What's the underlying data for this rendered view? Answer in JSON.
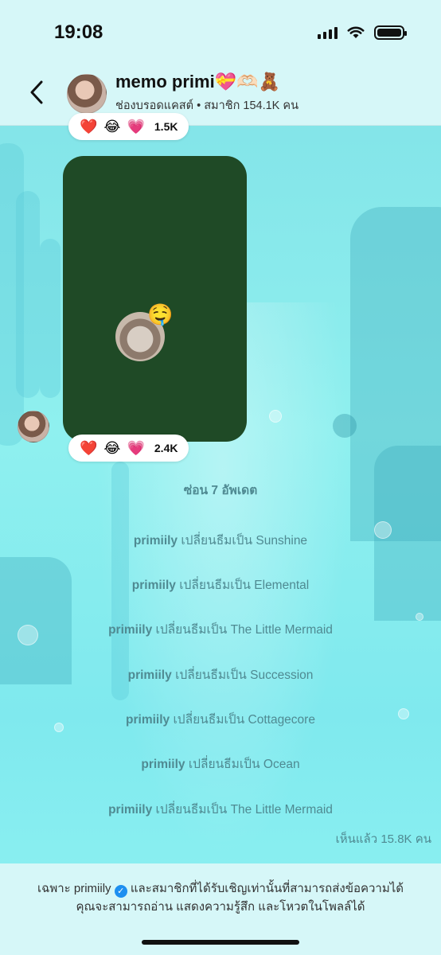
{
  "status_bar": {
    "time": "19:08"
  },
  "header": {
    "title": "memo primi💝🫶🏻🧸",
    "subtitle": "ช่องบรอดแคสต์ • สมาชิก 154.1K คน"
  },
  "messages": {
    "top_reactions": {
      "emojis": [
        "❤️",
        "😂",
        "💗"
      ],
      "count": "1.5K"
    },
    "media": {
      "emoji": "🤤"
    },
    "media_reactions": {
      "emojis": [
        "❤️",
        "😂",
        "💗"
      ],
      "count": "2.4K"
    }
  },
  "hidden_updates": "ซ่อน 7 อัพเดต",
  "theme_changes": [
    {
      "user": "primiily",
      "action": "เปลี่ยนธีมเป็น",
      "theme": "Sunshine"
    },
    {
      "user": "primiily",
      "action": "เปลี่ยนธีมเป็น",
      "theme": "Elemental"
    },
    {
      "user": "primiily",
      "action": "เปลี่ยนธีมเป็น",
      "theme": "The Little Mermaid"
    },
    {
      "user": "primiily",
      "action": "เปลี่ยนธีมเป็น",
      "theme": "Succession"
    },
    {
      "user": "primiily",
      "action": "เปลี่ยนธีมเป็น",
      "theme": "Cottagecore"
    },
    {
      "user": "primiily",
      "action": "เปลี่ยนธีมเป็น",
      "theme": "Ocean"
    },
    {
      "user": "primiily",
      "action": "เปลี่ยนธีมเป็น",
      "theme": "The Little Mermaid"
    }
  ],
  "seen": "เห็นแล้ว 15.8K คน",
  "footer": {
    "prefix": "เฉพาะ",
    "user": "primiily",
    "line1_rest": "และสมาชิกที่ได้รับเชิญเท่านั้นที่สามารถส่งข้อความได้",
    "line2": "คุณจะสามารถอ่าน แสดงความรู้สึก และโหวตในโพลล์ได้"
  },
  "colors": {
    "theme_background": "#8ff0ef",
    "header_background": "#d6f7f8",
    "system_text": "#4f8a92",
    "media_background": "#1f4a26",
    "verified_badge": "#1d8ff0"
  },
  "icons": [
    "back-chevron-icon",
    "signal-icon",
    "wifi-icon",
    "battery-icon",
    "verified-badge-icon"
  ]
}
